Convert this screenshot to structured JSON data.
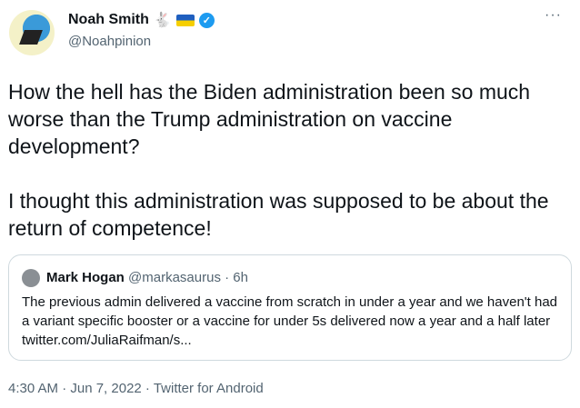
{
  "author": {
    "name": "Noah Smith",
    "emoji": "🐇",
    "handle": "@Noahpinion"
  },
  "tweet": {
    "text": "How the hell has the Biden administration been so much worse than the Trump administration on vaccine development?\n\nI thought this administration was supposed to be about the return of competence!"
  },
  "quote": {
    "name": "Mark Hogan",
    "handle": "@markasaurus",
    "time": "· 6h",
    "text": "The previous admin delivered a vaccine from scratch in under a year and we haven't had a variant specific booster or a vaccine for under 5s delivered now a year and a half later twitter.com/JuliaRaifman/s..."
  },
  "meta": {
    "text": "4:30 AM · Jun 7, 2022 · Twitter for Android"
  },
  "more_label": "···"
}
